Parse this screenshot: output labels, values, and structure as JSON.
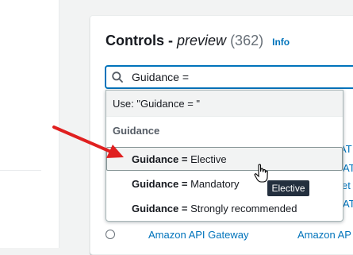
{
  "header": {
    "title": "Controls -",
    "title_italic": "preview",
    "count": "(362)",
    "info_link": "Info"
  },
  "search": {
    "value": "Guidance ="
  },
  "dropdown": {
    "use_text": "Use: \"Guidance = \"",
    "group_label": "Guidance",
    "options": [
      {
        "key": "Guidance =",
        "value": "Elective"
      },
      {
        "key": "Guidance =",
        "value": "Mandatory"
      },
      {
        "key": "Guidance =",
        "value": "Strongly recommended"
      }
    ]
  },
  "tooltip": "Elective",
  "background_rows": {
    "row1_fragments": [
      "AT",
      "AT",
      "et",
      "AT"
    ],
    "last_row_service": "Amazon API Gateway",
    "last_row_link2": "Amazon AP"
  },
  "colors": {
    "accent": "#0073bb",
    "annotation_arrow": "#e02020"
  }
}
